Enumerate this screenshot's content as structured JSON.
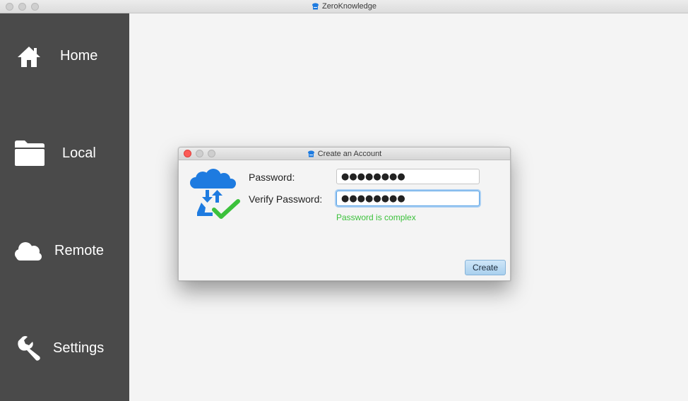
{
  "window": {
    "title": "ZeroKnowledge",
    "app_icon": "zeroknowledge-logo-icon"
  },
  "sidebar": {
    "background": "#4a4a4a",
    "items": [
      {
        "label": "Home",
        "icon": "home-icon"
      },
      {
        "label": "Local",
        "icon": "folder-icon"
      },
      {
        "label": "Remote",
        "icon": "cloud-icon"
      },
      {
        "label": "Settings",
        "icon": "wrench-icon"
      }
    ]
  },
  "dialog": {
    "title": "Create an Account",
    "logo_icon": "cloud-sync-check-icon",
    "password_label": "Password:",
    "password_value": "●●●●●●●●",
    "verify_label": "Verify Password:",
    "verify_value": "●●●●●●●●",
    "status_text": "Password is complex",
    "status_color": "#3cc13c",
    "create_label": "Create"
  },
  "colors": {
    "accent_blue": "#1e7be0",
    "check_green": "#3cc13c",
    "close_red": "#fc5b57"
  }
}
